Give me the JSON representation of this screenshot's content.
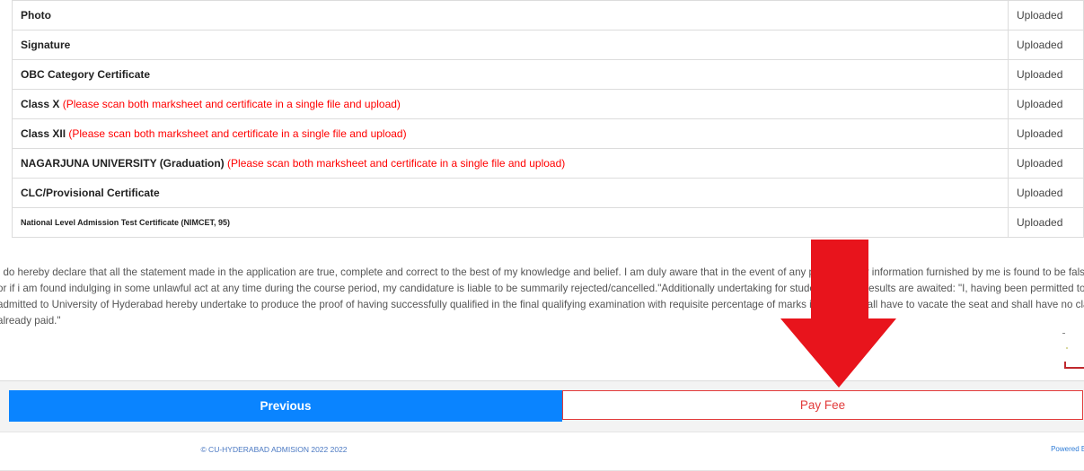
{
  "documents": [
    {
      "name": "Photo",
      "note": "",
      "status": "Uploaded"
    },
    {
      "name": "Signature",
      "note": "",
      "status": "Uploaded"
    },
    {
      "name": "OBC Category Certificate",
      "note": "",
      "status": "Uploaded"
    },
    {
      "name": "Class X",
      "note": "(Please scan both marksheet and certificate in a single file and upload)",
      "status": "Uploaded"
    },
    {
      "name": "Class XII",
      "note": "(Please scan both marksheet and certificate in a single file and upload)",
      "status": "Uploaded"
    },
    {
      "name": "NAGARJUNA UNIVERSITY (Graduation)",
      "note": "(Please scan both marksheet and certificate in a single file and upload)",
      "status": "Uploaded"
    },
    {
      "name": "CLC/Provisional Certificate",
      "note": "",
      "status": "Uploaded"
    },
    {
      "name": "National Level Admission Test Certificate (NIMCET, 95)",
      "note": "",
      "status": "Uploaded"
    }
  ],
  "declaration": {
    "lines": [
      "I do hereby declare that all the statement made in the application are true, complete and correct to the best of my knowledge and belief. I am duly aware that in the event of any particulars or information furnished by me is found to be false/incorrect/incomplete",
      "or if i am found indulging in some unlawful act at any time during the course period, my candidature is liable to be summarily rejected/cancelled.\"Additionally undertaking for students whose results are awaited: \"I, having been permitted to be provisionally",
      "admitted to University of Hyderabad hereby undertake to produce the proof of having successfully qualified in the final qualifying examination with requisite percentage of marks if failing, I shall have to vacate the seat and shall have no claim for refund of fee",
      "already paid.\""
    ]
  },
  "actions": {
    "previous_label": "Previous",
    "pay_fee_label": "Pay Fee"
  },
  "footer": {
    "copyright": "© CU-HYDERABAD ADMISION 2022 2022",
    "powered_by": "Powered By: P"
  },
  "colors": {
    "accent_blue": "#0a84ff",
    "pay_red": "#e23b3b",
    "note_red": "#ff0000",
    "arrow_red": "#e8141c"
  },
  "annotation": {
    "icon": "down-arrow-icon"
  }
}
